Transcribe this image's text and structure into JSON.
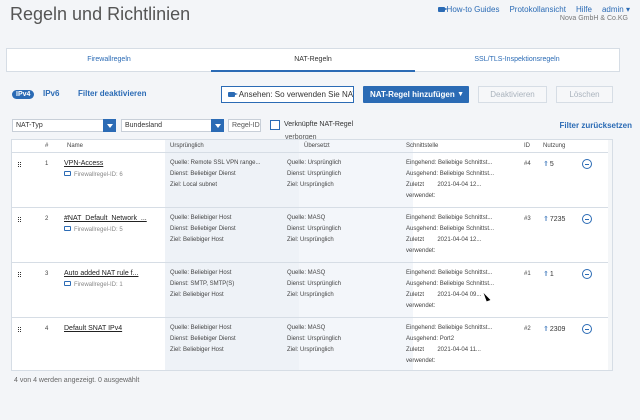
{
  "header": {
    "title": "Regeln und Richtlinien",
    "links": [
      "How-to Guides",
      "Protokollansicht",
      "Hilfe",
      "admin ▾"
    ],
    "company": "Nova GmbH & Co.KG"
  },
  "tabs": [
    {
      "label": "Firewallregeln"
    },
    {
      "label": "NAT-Regeln"
    },
    {
      "label": "SSL/TLS-Inspektionsregeln"
    }
  ],
  "toolbar": {
    "ipv4": "IPv4",
    "ipv6": "IPv6",
    "filter_deactivated": "Filter deaktivieren",
    "video_label": "Ansehen: So verwenden Sie NAT",
    "add_label": "NAT-Regel hinzufügen",
    "deactivate_label": "Deaktivieren",
    "delete_label": "Löschen"
  },
  "filters": {
    "nat_type": "NAT-Typ",
    "state": "Bundesland",
    "rule_id_placeholder": "Regel-ID",
    "linked_label": "Verknüpfte NAT-Regel",
    "hidden_label": "verborgen",
    "reset": "Filter zurücksetzen"
  },
  "table": {
    "headers": {
      "num": "#",
      "name": "Name",
      "orig": "Ursprünglich",
      "trans": "Übersetzt",
      "iface": "Schnittstelle",
      "id": "ID",
      "usage": "Nutzung"
    },
    "rows": [
      {
        "num": "1",
        "name": "VPN-Access",
        "sub": "Firewallregel-ID: 6",
        "orig": [
          "Quelle: Remote SSL VPN range...",
          "Dienst: Beliebiger Dienst",
          "Ziel: Local subnet"
        ],
        "trans": [
          "Quelle: Ursprünglich",
          "Dienst: Ursprünglich",
          "Ziel: Ursprünglich"
        ],
        "iface": [
          "Eingehend: Beliebige Schnittst...",
          "Ausgehend: Beliebige Schnittst...",
          "Zuletzt        2021-04-04 12...",
          "verwendet:"
        ],
        "id": "#4",
        "usage": "5"
      },
      {
        "num": "2",
        "name": "#NAT_Default_Network_...",
        "sub": "Firewallregel-ID: 5",
        "orig": [
          "Quelle: Beliebiger Host",
          "Dienst: Beliebiger Dienst",
          "Ziel: Beliebiger Host"
        ],
        "trans": [
          "Quelle: MASQ",
          "Dienst: Ursprünglich",
          "Ziel: Ursprünglich"
        ],
        "iface": [
          "Eingehend: Beliebige Schnittst...",
          "Ausgehend: Beliebige Schnittst...",
          "Zuletzt        2021-04-04 12...",
          "verwendet:"
        ],
        "id": "#3",
        "usage": "7235"
      },
      {
        "num": "3",
        "name": "Auto added NAT rule f...",
        "sub": "Firewallregel-ID: 1",
        "orig": [
          "Quelle: Beliebiger Host",
          "Dienst: SMTP, SMTP(S)",
          "Ziel: Beliebiger Host"
        ],
        "trans": [
          "Quelle: MASQ",
          "Dienst: Ursprünglich",
          "Ziel: Ursprünglich"
        ],
        "iface": [
          "Eingehend: Beliebige Schnittst...",
          "Ausgehend: Beliebige Schnittst...",
          "Zuletzt        2021-04-04 09...",
          "verwendet:"
        ],
        "id": "#1",
        "usage": "1"
      },
      {
        "num": "4",
        "name": "Default SNAT IPv4",
        "sub": "",
        "orig": [
          "Quelle: Beliebiger Host",
          "Dienst: Beliebiger Dienst",
          "Ziel: Beliebiger Host"
        ],
        "trans": [
          "Quelle: MASQ",
          "Dienst: Ursprünglich",
          "Ziel: Ursprünglich"
        ],
        "iface": [
          "Eingehend: Beliebige Schnittst...",
          "Ausgehend: Port2",
          "Zuletzt        2021-04-04 11...",
          "verwendet:"
        ],
        "id": "#2",
        "usage": "2309"
      }
    ]
  },
  "footer": "4 von 4 werden angezeigt. 0 ausgewählt"
}
